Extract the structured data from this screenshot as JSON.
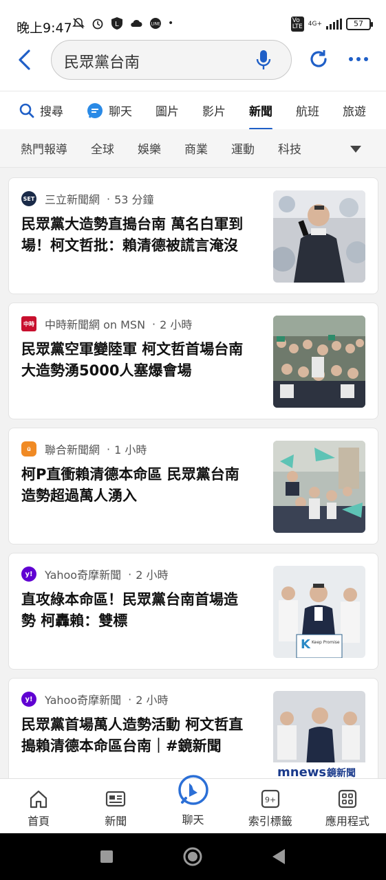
{
  "status_bar": {
    "time": "晚上9:47",
    "network": "4G+",
    "battery": "57"
  },
  "search": {
    "query": "民眾黨台南"
  },
  "tabs": [
    {
      "label": "搜尋",
      "icon": "search-icon"
    },
    {
      "label": "聊天",
      "icon": "chat-icon"
    },
    {
      "label": "圖片"
    },
    {
      "label": "影片"
    },
    {
      "label": "新聞",
      "active": true
    },
    {
      "label": "航班"
    },
    {
      "label": "旅遊"
    }
  ],
  "categories": [
    "熱門報導",
    "全球",
    "娛樂",
    "商業",
    "運動",
    "科技"
  ],
  "articles": [
    {
      "source": "三立新聞網",
      "time": "53 分鐘",
      "title": "民眾黨大造勢直搗台南 萬名白軍到場！柯文哲批：賴清德被謊言淹沒",
      "logo_color": "#1a2a48",
      "logo_text": "SET"
    },
    {
      "source": "中時新聞網 on MSN",
      "time": "2 小時",
      "title": "民眾黨空軍變陸軍 柯文哲首場台南大造勢湧5000人塞爆會場",
      "logo_color": "#c8102e",
      "logo_text": "中時"
    },
    {
      "source": "聯合新聞網",
      "time": "1 小時",
      "title": "柯P直衝賴清德本命區 民眾黨台南造勢超過萬人湧入",
      "logo_color": "#f08a24",
      "logo_text": "ü"
    },
    {
      "source": "Yahoo奇摩新聞",
      "time": "2 小時",
      "title": "直攻綠本命區！民眾黨台南首場造勢 柯轟賴：雙標",
      "logo_color": "#6001d2",
      "logo_text": "y!"
    },
    {
      "source": "Yahoo奇摩新聞",
      "time": "2 小時",
      "title": "民眾黨首場萬人造勢活動 柯文哲直搗賴清德本命區台南｜#鏡新聞",
      "logo_color": "#6001d2",
      "logo_text": "y!"
    }
  ],
  "thumb_captions": {
    "keep_promise": "Keep Promise",
    "mnews": "mnews",
    "mnews_cn": "鏡新聞"
  },
  "bottom_nav": [
    {
      "label": "首頁",
      "icon": "home-icon"
    },
    {
      "label": "新聞",
      "icon": "news-icon"
    },
    {
      "label": "聊天",
      "icon": "bing-chat-icon"
    },
    {
      "label": "索引標籤",
      "icon": "tabs-icon",
      "badge": "9+"
    },
    {
      "label": "應用程式",
      "icon": "apps-icon"
    }
  ],
  "colors": {
    "accent": "#1f5fc7",
    "bing_blue": "#2b6fd6"
  }
}
